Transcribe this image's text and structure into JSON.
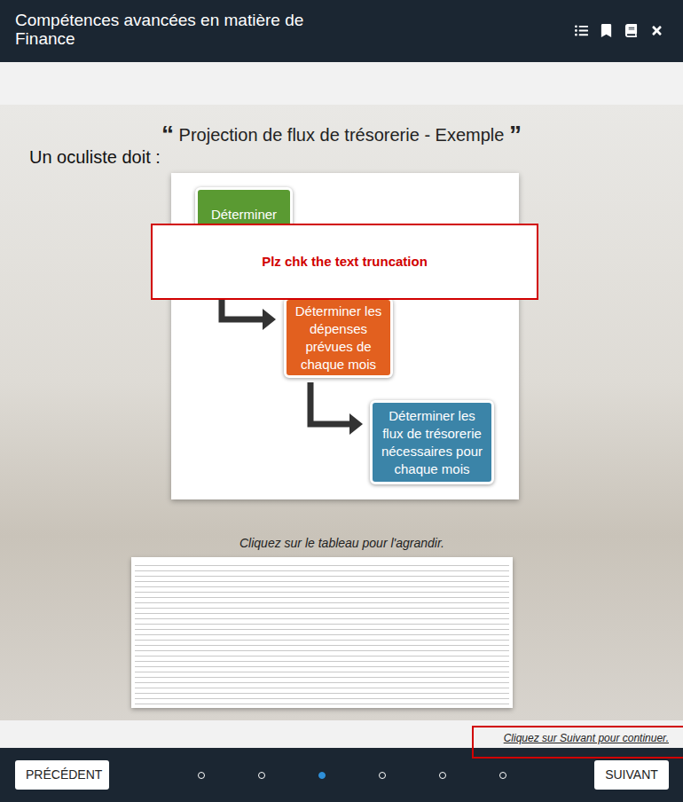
{
  "window": {
    "title": "Compétences avancées en matière de Finance"
  },
  "slide": {
    "quote_open": "“",
    "title": "Projection de flux de trésorerie - Exemple",
    "quote_close": "”",
    "intro": "Un oculiste doit :",
    "steps": [
      {
        "label": "Déterminer les",
        "color": "#5a9a32"
      },
      {
        "label": "Déterminer les dépenses prévues de chaque mois",
        "color": "#e2601f"
      },
      {
        "label": "Déterminer les flux de trésorerie nécessaires pour chaque mois",
        "color": "#3b84a8"
      }
    ],
    "table_hint": "Cliquez sur le tableau pour l'agrandir."
  },
  "annotations": [
    {
      "text": "Plz chk the text truncation"
    },
    {
      "text": ""
    }
  ],
  "continue_hint": "Cliquez sur Suivant pour continuer.",
  "footer": {
    "prev": "PRÉCÉDENT",
    "next": "SUIVANT",
    "dots": [
      {
        "selected": false
      },
      {
        "selected": false
      },
      {
        "selected": true
      },
      {
        "selected": false
      },
      {
        "selected": false
      },
      {
        "selected": false
      }
    ]
  }
}
